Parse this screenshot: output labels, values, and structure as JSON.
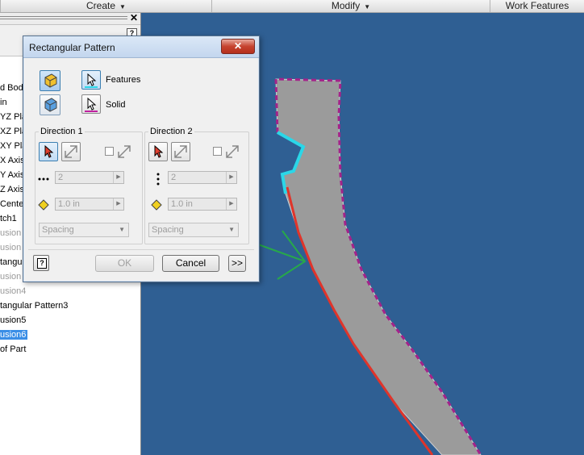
{
  "ribbon": {
    "tabs": [
      {
        "label": "Create"
      },
      {
        "label": "Modify"
      },
      {
        "label": "Work Features"
      }
    ]
  },
  "browser": {
    "items": [
      {
        "label": "d Bodie",
        "dim": false
      },
      {
        "label": "in",
        "dim": false
      },
      {
        "label": "YZ Pla",
        "dim": false
      },
      {
        "label": "XZ Pla",
        "dim": false
      },
      {
        "label": "XY Pla",
        "dim": false
      },
      {
        "label": "X Axis",
        "dim": false
      },
      {
        "label": "Y Axis",
        "dim": false
      },
      {
        "label": "Z Axis",
        "dim": false
      },
      {
        "label": "Cente",
        "dim": false
      },
      {
        "label": "tch1",
        "dim": false
      },
      {
        "label": "usion",
        "dim": true
      },
      {
        "label": "usion",
        "dim": true
      },
      {
        "label": "tangul",
        "dim": false
      },
      {
        "label": "usion",
        "dim": true
      },
      {
        "label": "usion4",
        "dim": true
      },
      {
        "label": "tangular Pattern3",
        "dim": false
      },
      {
        "label": "usion5",
        "dim": false
      },
      {
        "label": "usion6",
        "dim": false,
        "selected": true
      },
      {
        "label": "of Part",
        "dim": false
      }
    ]
  },
  "dialog": {
    "title": "Rectangular Pattern",
    "close": "✕",
    "features_label": "Features",
    "solid_label": "Solid",
    "direction1": {
      "title": "Direction 1",
      "count": "2",
      "spacing": "1.0 in",
      "method": "Spacing"
    },
    "direction2": {
      "title": "Direction 2",
      "count": "2",
      "spacing": "1.0 in",
      "method": "Spacing"
    },
    "ok_label": "OK",
    "cancel_label": "Cancel",
    "more_label": ">>",
    "help_glyph": "?"
  },
  "colors": {
    "viewport": "#2f5f93",
    "part": "#9b9b9b",
    "edge_highlight": "#a4238a",
    "face_highlight": "#2ad7e8",
    "pattern_path": "#e0342a",
    "arrow": "#27a84a"
  }
}
